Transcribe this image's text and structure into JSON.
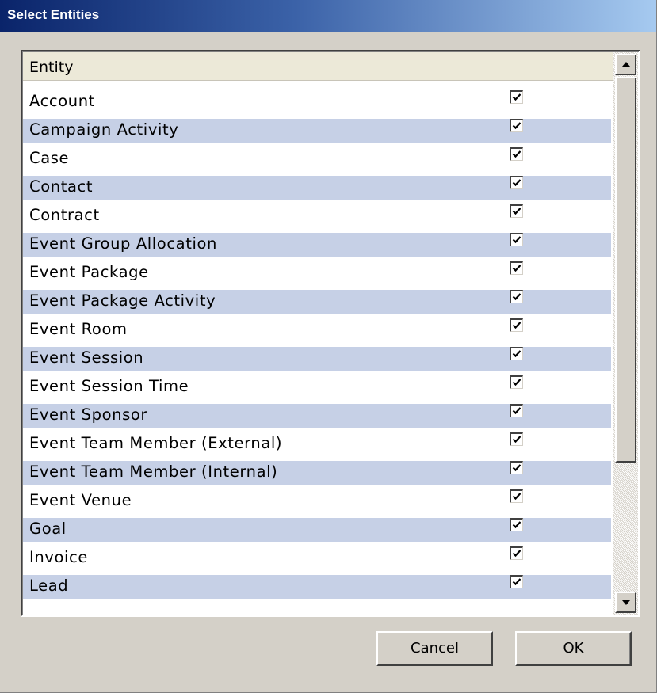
{
  "window": {
    "title": "Select Entities"
  },
  "list": {
    "column_header": "Entity",
    "alt_row_color": "#c6d0e6",
    "items": [
      {
        "label": "Account",
        "checked": true
      },
      {
        "label": "Campaign Activity",
        "checked": true
      },
      {
        "label": "Case",
        "checked": true
      },
      {
        "label": "Contact",
        "checked": true
      },
      {
        "label": "Contract",
        "checked": true
      },
      {
        "label": "Event Group Allocation",
        "checked": true
      },
      {
        "label": "Event Package",
        "checked": true
      },
      {
        "label": "Event Package Activity",
        "checked": true
      },
      {
        "label": "Event Room",
        "checked": true
      },
      {
        "label": "Event Session",
        "checked": true
      },
      {
        "label": "Event Session Time",
        "checked": true
      },
      {
        "label": "Event Sponsor",
        "checked": true
      },
      {
        "label": "Event Team Member (External)",
        "checked": true
      },
      {
        "label": "Event Team Member (Internal)",
        "checked": true
      },
      {
        "label": "Event Venue",
        "checked": true
      },
      {
        "label": "Goal",
        "checked": true
      },
      {
        "label": "Invoice",
        "checked": true
      },
      {
        "label": "Lead",
        "checked": true
      }
    ]
  },
  "buttons": {
    "cancel": "Cancel",
    "ok": "OK"
  },
  "icons": {
    "scroll_up": "scroll-up-arrow-icon",
    "scroll_down": "scroll-down-arrow-icon",
    "checkmark": "checkmark-icon"
  }
}
